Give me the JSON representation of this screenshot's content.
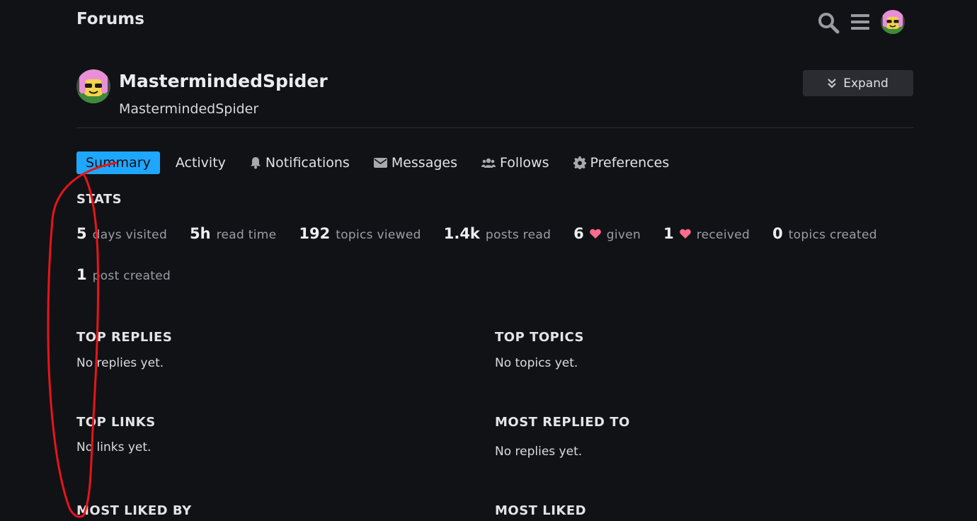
{
  "header": {
    "title": "Forums",
    "search_icon": "search-icon",
    "menu_icon": "hamburger-menu-icon"
  },
  "profile": {
    "display_name": "MastermindedSpider",
    "username": "MastermindedSpider",
    "expand_label": "Expand"
  },
  "tabs": [
    {
      "label": "Summary",
      "active": true
    },
    {
      "label": "Activity"
    },
    {
      "label": "Notifications",
      "icon": "bell-icon"
    },
    {
      "label": "Messages",
      "icon": "envelope-icon"
    },
    {
      "label": "Follows",
      "icon": "users-icon"
    },
    {
      "label": "Preferences",
      "icon": "gear-icon"
    }
  ],
  "stats": {
    "heading": "STATS",
    "items": [
      {
        "value": "5",
        "label": "days visited"
      },
      {
        "value": "5h",
        "label": "read time"
      },
      {
        "value": "192",
        "label": "topics viewed"
      },
      {
        "value": "1.4k",
        "label": "posts read"
      },
      {
        "value": "6",
        "label": "given",
        "heart": true
      },
      {
        "value": "1",
        "label": "received",
        "heart": true
      },
      {
        "value": "0",
        "label": "topics created"
      },
      {
        "value": "1",
        "label": "post created"
      }
    ]
  },
  "sections": {
    "top_replies": {
      "heading": "TOP REPLIES",
      "empty": "No replies yet."
    },
    "top_topics": {
      "heading": "TOP TOPICS",
      "empty": "No topics yet."
    },
    "top_links": {
      "heading": "TOP LINKS",
      "empty": "No links yet."
    },
    "most_replied_to": {
      "heading": "MOST REPLIED TO",
      "empty": "No replies yet."
    },
    "most_liked_by": {
      "heading": "MOST LIKED BY"
    },
    "most_liked": {
      "heading": "MOST LIKED"
    }
  },
  "colors": {
    "background": "#111216",
    "accent": "#1ea7fd",
    "heart": "#fa6c8d",
    "annotation": "#e8141a"
  }
}
